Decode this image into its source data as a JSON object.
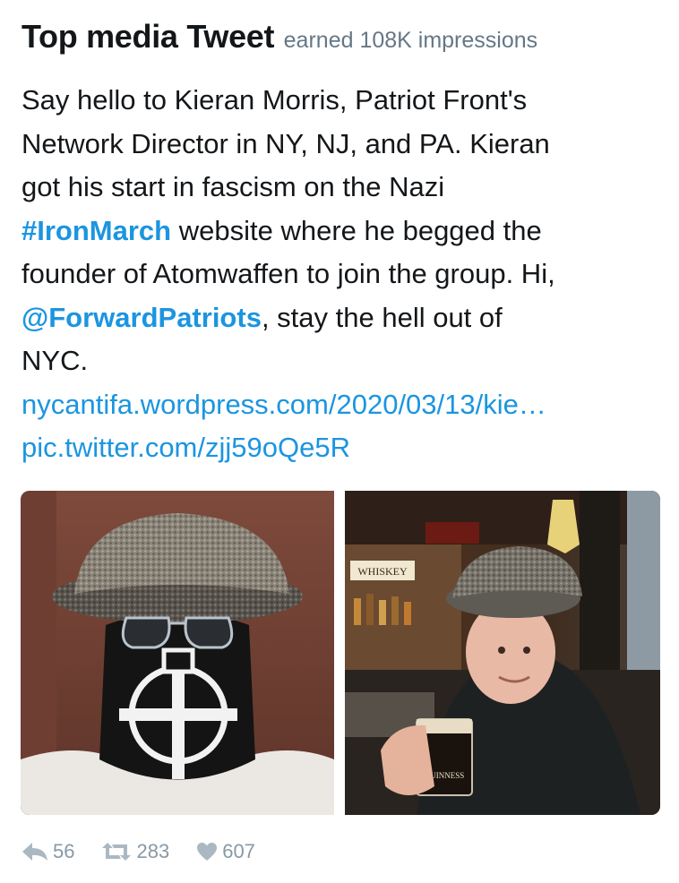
{
  "header": {
    "title": "Top media Tweet",
    "subtitle": "earned 108K impressions"
  },
  "tweet": {
    "line1": "Say hello to Kieran Morris, Patriot Front's",
    "line2": "Network Director in NY, NJ, and PA. Kieran",
    "line3": "got his start in fascism on the Nazi",
    "hashtag": "#IronMarch",
    "line4_rest": " website where he begged the",
    "line5": "founder of Atomwaffen to join the group. Hi,",
    "mention": "@ForwardPatriots",
    "line6_rest": ", stay the hell out of",
    "line7": "NYC.",
    "url": "nycantifa.wordpress.com/2020/03/13/kie…",
    "pic_link": "pic.twitter.com/zjj59oQe5R"
  },
  "media": {
    "photo_left": {
      "icon": "photo-masked-man"
    },
    "photo_right": {
      "icon": "photo-man-with-pint",
      "sign_text": "WHISKEY",
      "glass_text": "GUINNESS"
    }
  },
  "actions": {
    "replies": "56",
    "retweets": "283",
    "likes": "607",
    "icon_color": "#aab8c2"
  },
  "colors": {
    "link": "#1b95e0",
    "text": "#14171a",
    "muted": "#657786",
    "actions": "#8899a6"
  }
}
